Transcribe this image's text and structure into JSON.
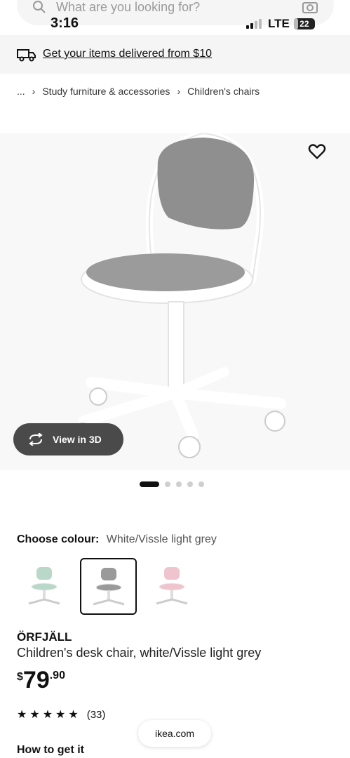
{
  "search": {
    "placeholder": "What are you looking for?"
  },
  "status_bar": {
    "time": "3:16",
    "network": "LTE",
    "battery": "22"
  },
  "delivery_banner": {
    "text": "Get your items delivered from $10"
  },
  "breadcrumb": {
    "ellipsis": "...",
    "items": [
      "Study furniture & accessories",
      "Children's chairs"
    ]
  },
  "gallery": {
    "view_3d_label": "View in 3D",
    "dot_count": 5,
    "active_index": 0
  },
  "colour": {
    "label": "Choose colour:",
    "selected": "White/Vissle light grey",
    "swatches": [
      {
        "seat_color": "#b9d8c9",
        "selected": false
      },
      {
        "seat_color": "#9a9a9a",
        "selected": true
      },
      {
        "seat_color": "#f0c4cf",
        "selected": false
      }
    ]
  },
  "product": {
    "name": "ÖRFJÄLL",
    "description": "Children's desk chair, white/Vissle light grey",
    "price_currency": "$",
    "price_integer": "79",
    "price_decimal": ".90",
    "rating_stars": 5,
    "review_count": "(33)"
  },
  "section": {
    "how_to_get": "How to get it"
  },
  "browser": {
    "url": "ikea.com"
  }
}
